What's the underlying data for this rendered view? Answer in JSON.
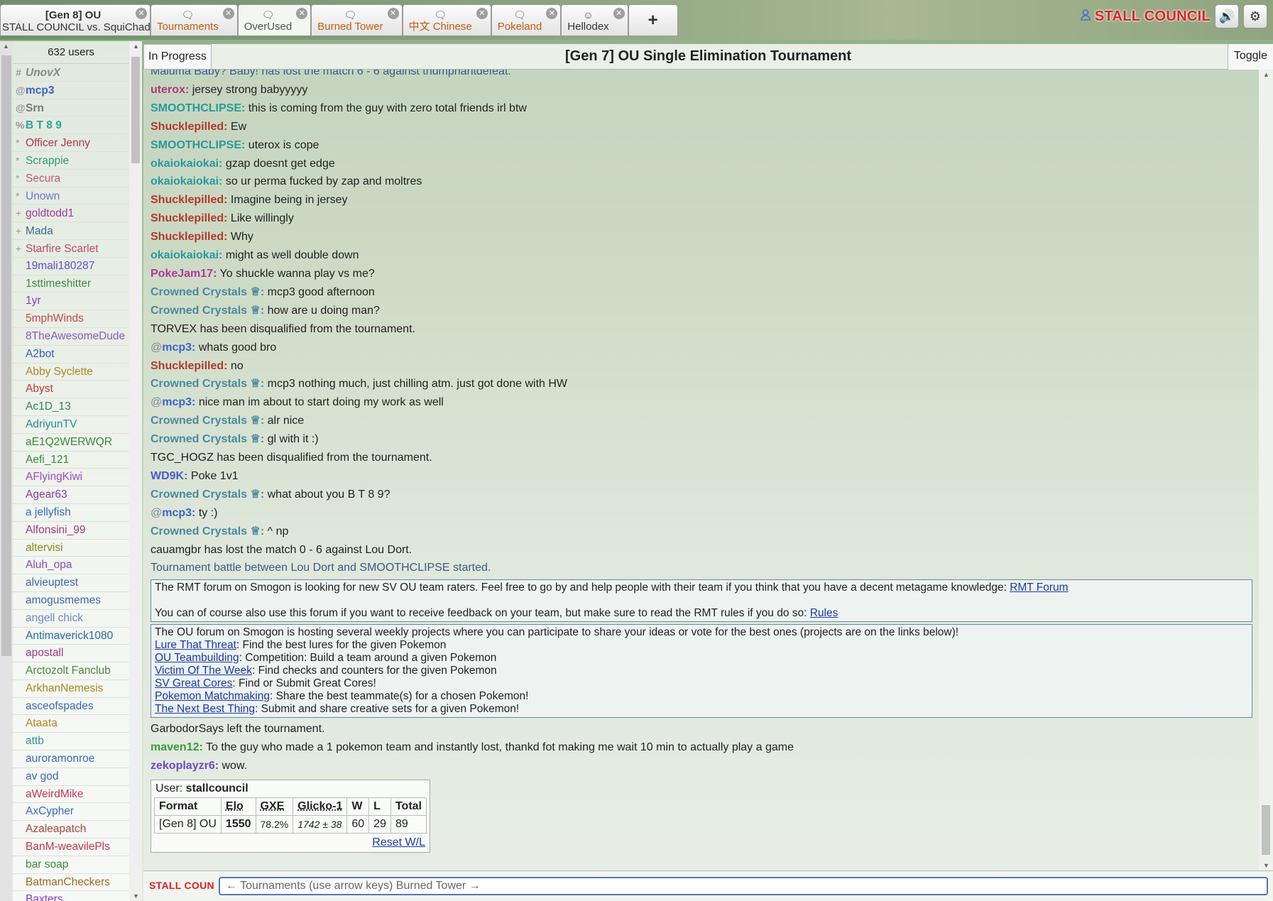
{
  "tabs": {
    "battle": {
      "line1": "[Gen 8] OU",
      "line2": "STALL COUNCIL vs. SquiChad"
    },
    "rooms": [
      {
        "label": "Tournaments",
        "name": "tab-tournaments",
        "current": false
      },
      {
        "label": "OverUsed",
        "name": "tab-overused",
        "current": true
      },
      {
        "label": "Burned Tower",
        "name": "tab-burned-tower",
        "current": false
      },
      {
        "label": "中文 Chinese",
        "name": "tab-chinese",
        "current": false
      },
      {
        "label": "Pokeland",
        "name": "tab-pokeland",
        "current": false
      },
      {
        "label": "Hellodex",
        "name": "tab-hellodex",
        "current": false,
        "icon": "smiley-icon"
      }
    ],
    "plus_label": "+",
    "close_glyph": "✕",
    "chat_icon_glyph": "🗨",
    "smiley_glyph": "☺"
  },
  "user": {
    "name": "STALL COUNCIL",
    "color": "#e02020",
    "icon": "user-icon",
    "sound_icon": "🔊",
    "gear_icon": "⚙"
  },
  "userlist": {
    "count": "632 users",
    "users": [
      {
        "rank": "#",
        "name": "UnovX",
        "color": "#888888",
        "style": "bold ital"
      },
      {
        "rank": "@",
        "name": "mcp3",
        "color": "#3b64c8",
        "style": "bold"
      },
      {
        "rank": "@",
        "name": "Srn",
        "color": "#777777",
        "style": "bold"
      },
      {
        "rank": "%",
        "name": "B T 8 9",
        "color": "#2aa6a0",
        "style": "bold"
      },
      {
        "rank": "*",
        "name": "Officer Jenny",
        "color": "#b0384a",
        "style": ""
      },
      {
        "rank": "*",
        "name": "Scrappie",
        "color": "#3a9a6a",
        "style": ""
      },
      {
        "rank": "*",
        "name": "Secura",
        "color": "#c05a78",
        "style": ""
      },
      {
        "rank": "*",
        "name": "Unown",
        "color": "#6a78c8",
        "style": ""
      },
      {
        "rank": "+",
        "name": "goldtodd1",
        "color": "#a03aa0",
        "style": ""
      },
      {
        "rank": "+",
        "name": "Mada",
        "color": "#3a6a8a",
        "style": ""
      },
      {
        "rank": "+",
        "name": "Starfire Scarlet",
        "color": "#c04a6a",
        "style": ""
      },
      {
        "rank": "",
        "name": "19mali180287",
        "color": "#6a4ac8",
        "style": ""
      },
      {
        "rank": "",
        "name": "1sttimeshitter",
        "color": "#3a8a4a",
        "style": ""
      },
      {
        "rank": "",
        "name": "1yr",
        "color": "#8a3ac0",
        "style": ""
      },
      {
        "rank": "",
        "name": "5mphWinds",
        "color": "#c04a4a",
        "style": ""
      },
      {
        "rank": "",
        "name": "8TheAwesomeDude",
        "color": "#8a5ac0",
        "style": ""
      },
      {
        "rank": "",
        "name": "A2bot",
        "color": "#3a5ac0",
        "style": ""
      },
      {
        "rank": "",
        "name": "Abby Syclette",
        "color": "#b08a20",
        "style": ""
      },
      {
        "rank": "",
        "name": "Abyst",
        "color": "#c03a3a",
        "style": ""
      },
      {
        "rank": "",
        "name": "Ac1D_13",
        "color": "#2a8a5a",
        "style": ""
      },
      {
        "rank": "",
        "name": "AdriyunTV",
        "color": "#2a8aa0",
        "style": ""
      },
      {
        "rank": "",
        "name": "aE1Q2WERWQR",
        "color": "#3a8a3a",
        "style": ""
      },
      {
        "rank": "",
        "name": "Aefi_121",
        "color": "#3a8a3a",
        "style": ""
      },
      {
        "rank": "",
        "name": "AFlyingKiwi",
        "color": "#a04ac0",
        "style": ""
      },
      {
        "rank": "",
        "name": "Agear63",
        "color": "#8a3ab0",
        "style": ""
      },
      {
        "rank": "",
        "name": "a jellyfish",
        "color": "#3a6ac0",
        "style": ""
      },
      {
        "rank": "",
        "name": "Alfonsini_99",
        "color": "#a03a8a",
        "style": ""
      },
      {
        "rank": "",
        "name": "altervisi",
        "color": "#8a8a20",
        "style": ""
      },
      {
        "rank": "",
        "name": "Aluh_opa",
        "color": "#8a4ac0",
        "style": ""
      },
      {
        "rank": "",
        "name": "alvieuptest",
        "color": "#3a6ab0",
        "style": ""
      },
      {
        "rank": "",
        "name": "amogusmemes",
        "color": "#3a6ab0",
        "style": ""
      },
      {
        "rank": "",
        "name": "angell chick",
        "color": "#6a8ac0",
        "style": ""
      },
      {
        "rank": "",
        "name": "Antimaverick1080",
        "color": "#2a6aa0",
        "style": ""
      },
      {
        "rank": "",
        "name": "apostall",
        "color": "#a03a8a",
        "style": ""
      },
      {
        "rank": "",
        "name": "Arctozolt Fanclub",
        "color": "#4a8a3a",
        "style": ""
      },
      {
        "rank": "",
        "name": "ArkhanNemesis",
        "color": "#a08a20",
        "style": ""
      },
      {
        "rank": "",
        "name": "asceofspades",
        "color": "#3a6ab0",
        "style": ""
      },
      {
        "rank": "",
        "name": "Ataata",
        "color": "#b08a20",
        "style": ""
      },
      {
        "rank": "",
        "name": "attb",
        "color": "#2a9a9a",
        "style": ""
      },
      {
        "rank": "",
        "name": "auroramonroe",
        "color": "#3a6ab0",
        "style": ""
      },
      {
        "rank": "",
        "name": "av god",
        "color": "#3a6ab0",
        "style": ""
      },
      {
        "rank": "",
        "name": "aWeirdMike",
        "color": "#c03a5a",
        "style": ""
      },
      {
        "rank": "",
        "name": "AxCypher",
        "color": "#3a6ac0",
        "style": ""
      },
      {
        "rank": "",
        "name": "Azaleapatch",
        "color": "#a04a3a",
        "style": ""
      },
      {
        "rank": "",
        "name": "BanM-weavilePls",
        "color": "#c03a4a",
        "style": ""
      },
      {
        "rank": "",
        "name": "bar soap",
        "color": "#3a8a3a",
        "style": ""
      },
      {
        "rank": "",
        "name": "BatmanCheckers",
        "color": "#a06a20",
        "style": ""
      },
      {
        "rank": "",
        "name": "Baxters",
        "color": "#8a3ac0",
        "style": ""
      }
    ]
  },
  "room": {
    "status": "In Progress",
    "title": "[Gen 7] OU Single Elimination Tournament",
    "toggle": "Toggle"
  },
  "chat": [
    {
      "type": "cut",
      "text": "Maluma Baby? Baby! has lost the match 6 - 6 against triumphantdefeat."
    },
    {
      "type": "msg",
      "user": "uterox:",
      "color": "#b0387a",
      "text": "jersey strong babyyyyy"
    },
    {
      "type": "msg",
      "user": "SMOOTHCLIPSE:",
      "color": "#2a9a9a",
      "text": "this is coming from the guy with zero total friends irl btw"
    },
    {
      "type": "msg",
      "user": "Shucklepilled:",
      "color": "#b03a2a",
      "text": "Ew"
    },
    {
      "type": "msg",
      "user": "SMOOTHCLIPSE:",
      "color": "#2a9a9a",
      "text": "uterox is cope"
    },
    {
      "type": "msg",
      "user": "okaiokaiokai:",
      "color": "#2a9aa0",
      "text": "gzap doesnt get edge"
    },
    {
      "type": "msg",
      "user": "okaiokaiokai:",
      "color": "#2a9aa0",
      "text": "so ur perma fucked by zap and moltres"
    },
    {
      "type": "msg",
      "user": "Shucklepilled:",
      "color": "#b03a2a",
      "text": "Imagine being in jersey"
    },
    {
      "type": "msg",
      "user": "Shucklepilled:",
      "color": "#b03a2a",
      "text": "Like willingly"
    },
    {
      "type": "msg",
      "user": "Shucklepilled:",
      "color": "#b03a2a",
      "text": "Why"
    },
    {
      "type": "msg",
      "user": "okaiokaiokai:",
      "color": "#2a9aa0",
      "text": "might as well double down"
    },
    {
      "type": "msg",
      "user": "PokeJam17:",
      "color": "#b03a9a",
      "text": "Yo shuckle wanna play vs me?"
    },
    {
      "type": "msg",
      "user": "Crowned Crystals ♕:",
      "color": "#4a8aa0",
      "text": "mcp3 good afternoon"
    },
    {
      "type": "msg",
      "user": "Crowned Crystals ♕:",
      "color": "#4a8aa0",
      "text": "how are u doing man?"
    },
    {
      "type": "notice",
      "text": "TORVEX has been disqualified from the tournament."
    },
    {
      "type": "msg",
      "rank": "@",
      "user": "mcp3:",
      "color": "#3b64c8",
      "text": "whats good bro"
    },
    {
      "type": "msg",
      "user": "Shucklepilled:",
      "color": "#b03a2a",
      "text": "no"
    },
    {
      "type": "msg",
      "user": "Crowned Crystals ♕:",
      "color": "#4a8aa0",
      "text": "mcp3 nothing much, just chilling atm. just got done with HW"
    },
    {
      "type": "msg",
      "rank": "@",
      "user": "mcp3:",
      "color": "#3b64c8",
      "text": "nice man im about to start doing my work as well"
    },
    {
      "type": "msg",
      "user": "Crowned Crystals ♕:",
      "color": "#4a8aa0",
      "text": "alr nice"
    },
    {
      "type": "msg",
      "user": "Crowned Crystals ♕:",
      "color": "#4a8aa0",
      "text": "gl with it :)"
    },
    {
      "type": "notice",
      "text": "TGC_HOGZ has been disqualified from the tournament."
    },
    {
      "type": "msg",
      "user": "WD9K:",
      "color": "#4a5ac8",
      "text": "Poke 1v1"
    },
    {
      "type": "msg",
      "user": "Crowned Crystals ♕:",
      "color": "#4a8aa0",
      "text": "what about you B T 8 9?"
    },
    {
      "type": "msg",
      "rank": "@",
      "user": "mcp3:",
      "color": "#3b64c8",
      "text": "ty :)"
    },
    {
      "type": "msg",
      "user": "Crowned Crystals ♕:",
      "color": "#4a8aa0",
      "text": "^ np"
    },
    {
      "type": "notice",
      "text": "cauamgbr has lost the match 0 - 6 against Lou Dort."
    },
    {
      "type": "battlestart",
      "text": "Tournament battle between Lou Dort and SMOOTHCLIPSE started."
    }
  ],
  "infobox1": {
    "line1": "The RMT forum on Smogon is looking for new SV OU team raters. Feel free to go by and help people with their team if you think that you have a decent metagame knowledge: ",
    "link1": "RMT Forum",
    "line2": "You can of course also use this forum if you want to receive feedback on your team, but make sure to read the RMT rules if you do so: ",
    "link2": "Rules"
  },
  "infobox2": {
    "intro": "The OU forum on Smogon is hosting several weekly projects where you can participate to share your ideas or vote for the best ones (projects are on the links below)!",
    "items": [
      {
        "link": "Lure That Threat",
        "desc": ": Find the best lures for the given Pokemon"
      },
      {
        "link": "OU Teambuilding",
        "desc": ": Competition: Build a team around a given Pokemon"
      },
      {
        "link": "Victim Of The Week",
        "desc": ": Find checks and counters for the given Pokemon"
      },
      {
        "link": "SV Great Cores",
        "desc": ": Find or Submit Great Cores!"
      },
      {
        "link": "Pokemon Matchmaking",
        "desc": ": Share the best teammate(s) for a chosen Pokemon!"
      },
      {
        "link": "The Next Best Thing",
        "desc": ": Submit and share creative sets for a given Pokemon!"
      }
    ]
  },
  "chat_after": [
    {
      "type": "notice",
      "text": "GarbodorSays left the tournament."
    },
    {
      "type": "msg",
      "user": "maven12:",
      "color": "#3a9a3a",
      "text": "To the guy who made a 1 pokemon team and instantly lost, thankd fot making me wait 10 min to actually play a game"
    },
    {
      "type": "msg",
      "user": "zekoplayzr6:",
      "color": "#6a4ac8",
      "text": "wow."
    }
  ],
  "ladder": {
    "user_label": "User: ",
    "user_name": "stallcouncil",
    "headers": [
      "Format",
      "Elo",
      "GXE",
      "Glicko-1",
      "W",
      "L",
      "Total"
    ],
    "row": {
      "format": "[Gen 8] OU",
      "elo": "1550",
      "gxe": "78.2%",
      "glicko": "1742 ± 38",
      "w": "60",
      "l": "29",
      "total": "89"
    },
    "reset": "Reset W/L"
  },
  "compose": {
    "username": "STALL COUNCIL",
    "placeholder": "← Tournaments (use arrow keys) Burned Tower →"
  }
}
